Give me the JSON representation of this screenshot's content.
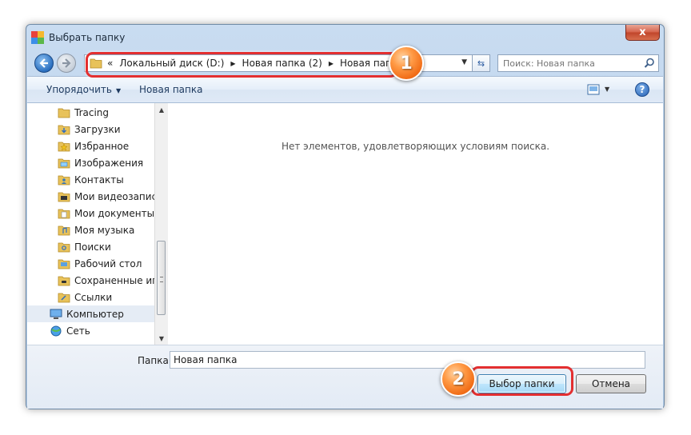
{
  "window": {
    "title": "Выбрать папку",
    "close_label": "x"
  },
  "address_bar": {
    "overflow": "«",
    "crumbs": [
      "Локальный диск (D:)",
      "Новая папка (2)",
      "Новая папка"
    ]
  },
  "search": {
    "placeholder": "Поиск: Новая папка"
  },
  "toolbar": {
    "organize_label": "Упорядочить",
    "new_folder_label": "Новая папка"
  },
  "tree": {
    "items": [
      {
        "label": "Tracing",
        "icon": "folder-icon"
      },
      {
        "label": "Загрузки",
        "icon": "downloads-folder-icon"
      },
      {
        "label": "Избранное",
        "icon": "favorites-folder-icon"
      },
      {
        "label": "Изображения",
        "icon": "pictures-folder-icon"
      },
      {
        "label": "Контакты",
        "icon": "contacts-folder-icon"
      },
      {
        "label": "Мои видеозапис",
        "icon": "videos-folder-icon"
      },
      {
        "label": "Мои документы",
        "icon": "documents-folder-icon"
      },
      {
        "label": "Моя музыка",
        "icon": "music-folder-icon"
      },
      {
        "label": "Поиски",
        "icon": "searches-folder-icon"
      },
      {
        "label": "Рабочий стол",
        "icon": "desktop-folder-icon"
      },
      {
        "label": "Сохраненные иг",
        "icon": "saved-games-folder-icon"
      },
      {
        "label": "Ссылки",
        "icon": "links-folder-icon"
      },
      {
        "label": "Компьютер",
        "icon": "computer-icon"
      },
      {
        "label": "Сеть",
        "icon": "network-icon"
      }
    ]
  },
  "content": {
    "empty_message": "Нет элементов, удовлетворяющих условиям поиска."
  },
  "bottom": {
    "folder_label": "Папка:",
    "folder_value": "Новая папка",
    "select_button": "Выбор папки",
    "cancel_button": "Отмена"
  },
  "annotations": {
    "marker_1": "1",
    "marker_2": "2",
    "highlight_color": "#e32f30",
    "marker_color": "#f07a1e"
  }
}
